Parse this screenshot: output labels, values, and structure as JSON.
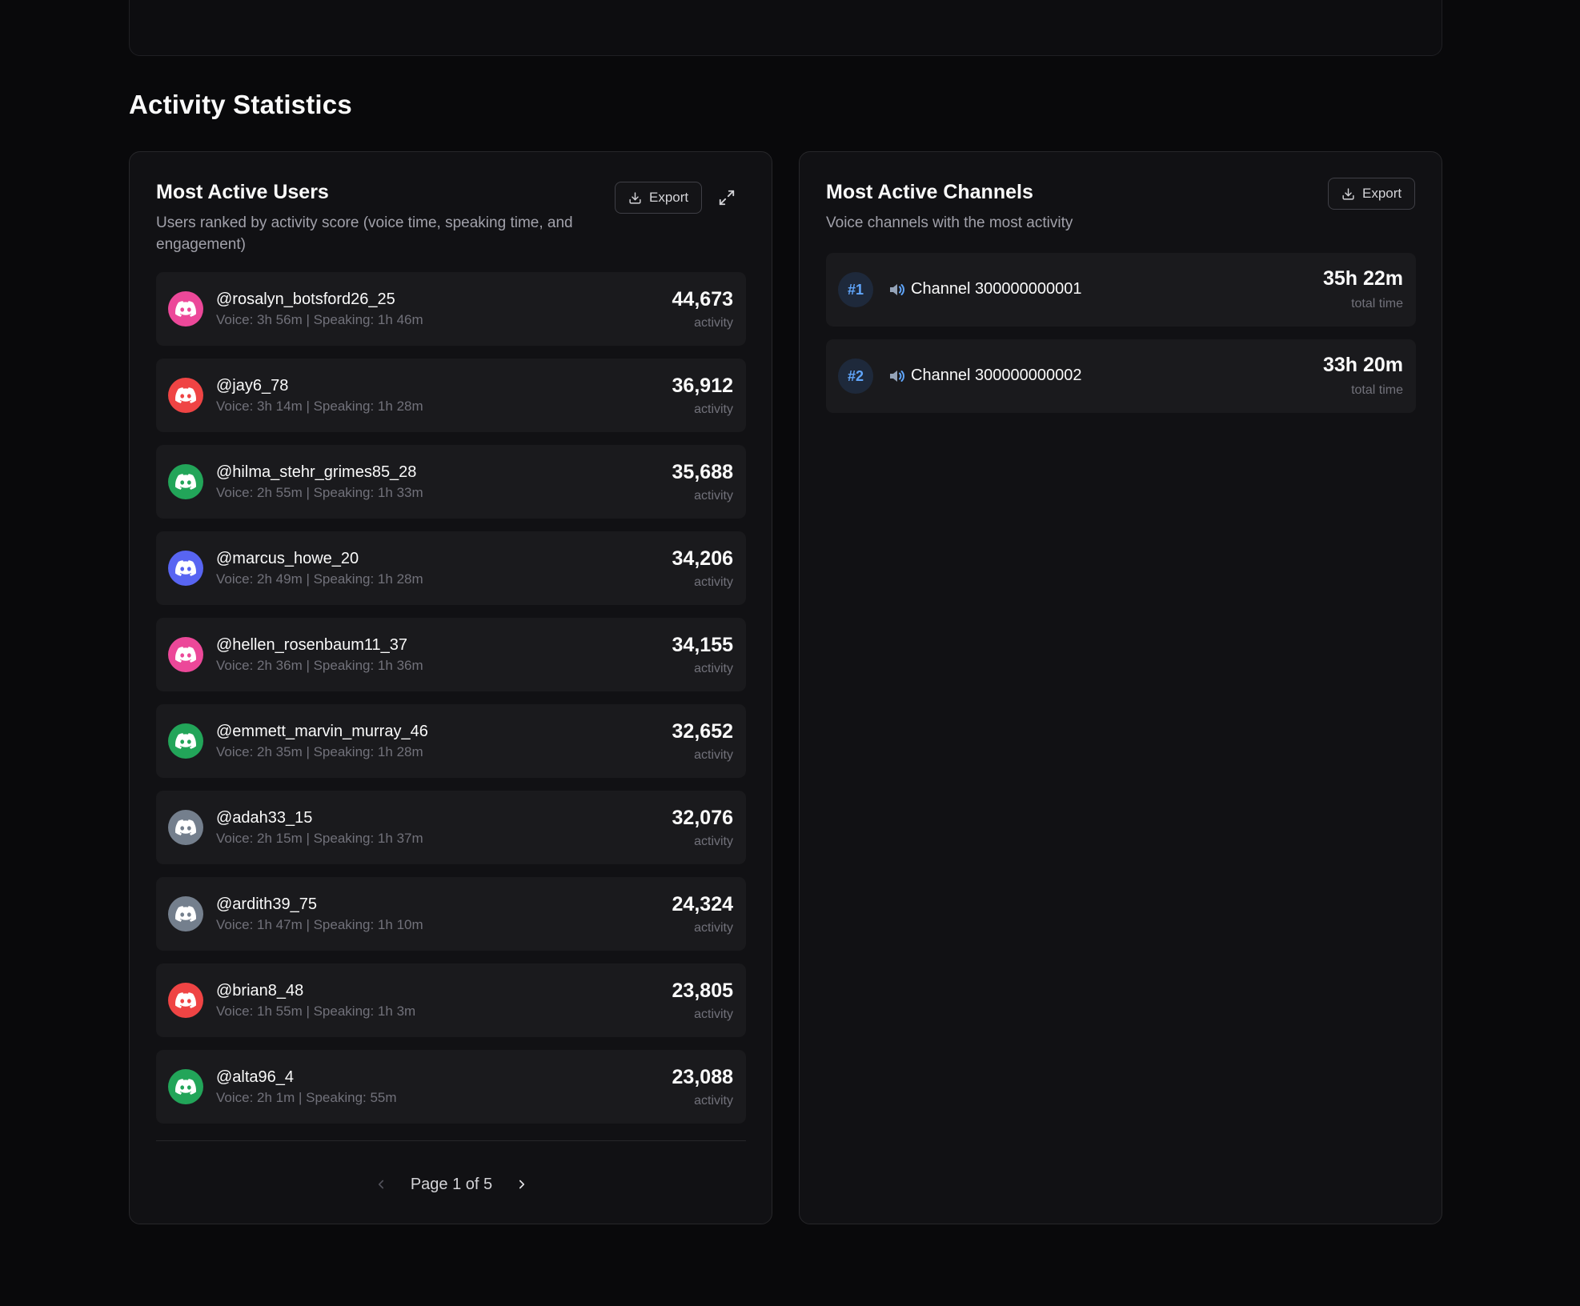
{
  "section_title": "Activity Statistics",
  "users_panel": {
    "title": "Most Active Users",
    "description": "Users ranked by activity score (voice time, speaking time, and engagement)",
    "export_label": "Export",
    "score_label": "activity",
    "users": [
      {
        "name": "@rosalyn_botsford26_25",
        "meta": "Voice: 3h 56m | Speaking: 1h 46m",
        "score": "44,673",
        "color": "#ec4899"
      },
      {
        "name": "@jay6_78",
        "meta": "Voice: 3h 14m | Speaking: 1h 28m",
        "score": "36,912",
        "color": "#ef4444"
      },
      {
        "name": "@hilma_stehr_grimes85_28",
        "meta": "Voice: 2h 55m | Speaking: 1h 33m",
        "score": "35,688",
        "color": "#22a559"
      },
      {
        "name": "@marcus_howe_20",
        "meta": "Voice: 2h 49m | Speaking: 1h 28m",
        "score": "34,206",
        "color": "#5865f2"
      },
      {
        "name": "@hellen_rosenbaum11_37",
        "meta": "Voice: 2h 36m | Speaking: 1h 36m",
        "score": "34,155",
        "color": "#ec4899"
      },
      {
        "name": "@emmett_marvin_murray_46",
        "meta": "Voice: 2h 35m | Speaking: 1h 28m",
        "score": "32,652",
        "color": "#22a559"
      },
      {
        "name": "@adah33_15",
        "meta": "Voice: 2h 15m | Speaking: 1h 37m",
        "score": "32,076",
        "color": "#747f8d"
      },
      {
        "name": "@ardith39_75",
        "meta": "Voice: 1h 47m | Speaking: 1h 10m",
        "score": "24,324",
        "color": "#747f8d"
      },
      {
        "name": "@brian8_48",
        "meta": "Voice: 1h 55m | Speaking: 1h 3m",
        "score": "23,805",
        "color": "#ef4444"
      },
      {
        "name": "@alta96_4",
        "meta": "Voice: 2h 1m | Speaking: 55m",
        "score": "23,088",
        "color": "#22a559"
      }
    ],
    "pagination": {
      "text": "Page 1 of 5"
    }
  },
  "channels_panel": {
    "title": "Most Active Channels",
    "description": "Voice channels with the most activity",
    "export_label": "Export",
    "time_label": "total time",
    "channels": [
      {
        "rank": "#1",
        "name": "Channel 300000000001",
        "time": "35h 22m"
      },
      {
        "rank": "#2",
        "name": "Channel 300000000002",
        "time": "33h 20m"
      }
    ]
  }
}
